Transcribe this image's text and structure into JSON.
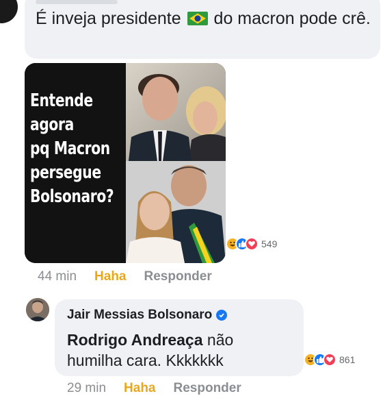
{
  "comment1": {
    "text_before_flag": "É inveja presidente",
    "flag_icon": "brazil-flag-icon",
    "text_after_flag": "do macron pode crê.",
    "reactions_count": "549",
    "time": "44 min",
    "haha_label": "Haha",
    "reply_label": "Responder"
  },
  "meme": {
    "lines": [
      "Entende",
      "agora",
      "pq Macron",
      "persegue",
      "Bolsonaro?"
    ]
  },
  "comment2": {
    "author": "Jair Messias Bolsonaro",
    "mention": "Rodrigo Andreaça",
    "text": " não humilha cara. Kkkkkkk",
    "reactions_count": "861",
    "time": "29 min",
    "haha_label": "Haha",
    "reply_label": "Responder"
  },
  "colors": {
    "haha": "#f7b125",
    "like": "#1877f2",
    "love": "#f33e58",
    "bubble": "#eff1f4"
  }
}
